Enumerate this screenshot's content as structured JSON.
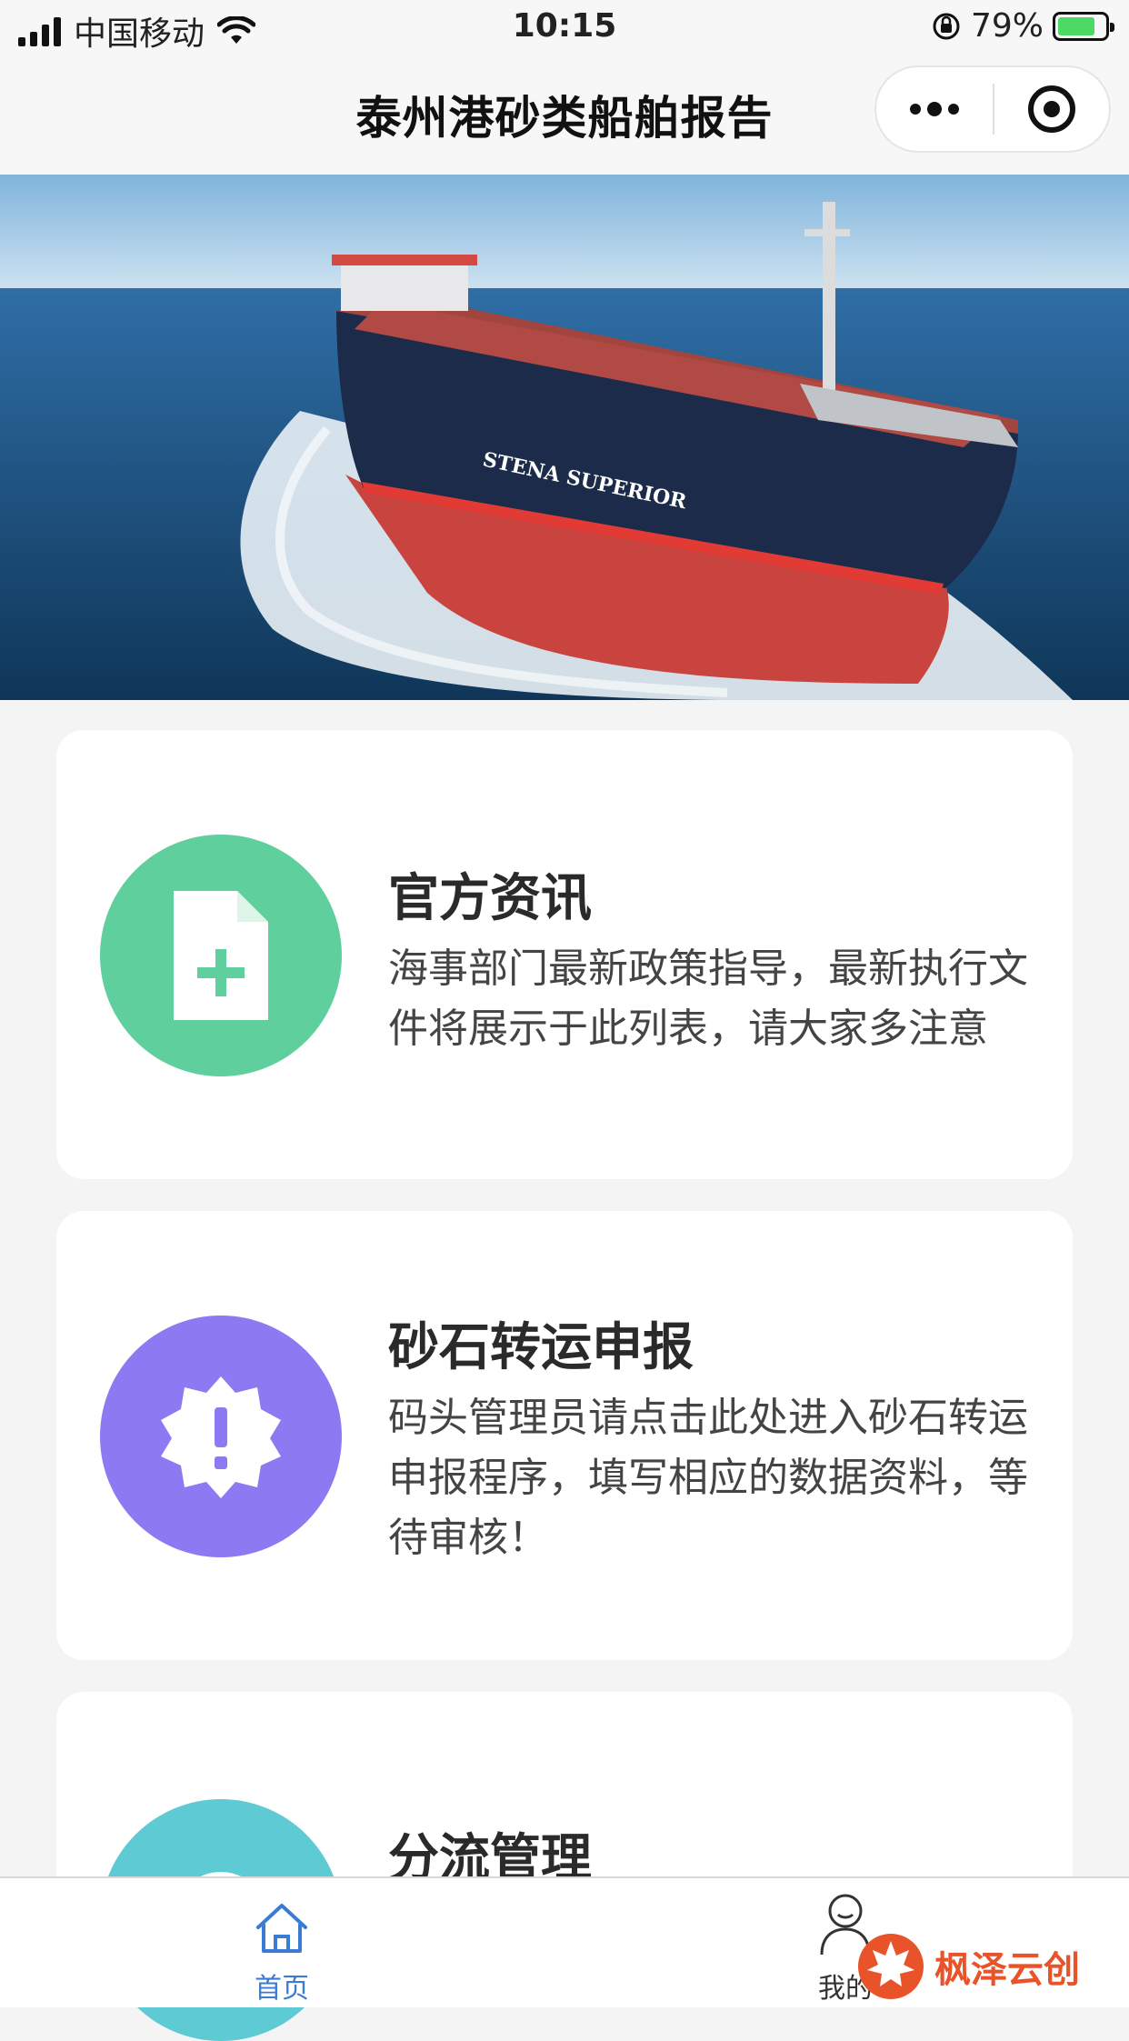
{
  "status_bar": {
    "carrier": "中国移动",
    "time": "10:15",
    "battery_percent": "79%",
    "battery_level": 0.79
  },
  "nav": {
    "title": "泰州港砂类船舶报告"
  },
  "banner": {
    "ship_name_text": "STENA SUPERIOR"
  },
  "cards": [
    {
      "title": "官方资讯",
      "desc": "海事部门最新政策指导，最新执行文件将展示于此列表，请大家多注意",
      "icon": "document-add-icon",
      "color": "#5fcf9d"
    },
    {
      "title": "砂石转运申报",
      "desc": "码头管理员请点击此处进入砂石转运申报程序，填写相应的数据资料，等待审核！",
      "icon": "alert-badge-icon",
      "color": "#8d7af2"
    },
    {
      "title": "分流管理",
      "desc": "",
      "icon": "diversion-icon",
      "color": "#5ecad3"
    }
  ],
  "tab_bar": {
    "tabs": [
      {
        "label": "首页",
        "icon": "home-icon",
        "active": true,
        "color": "#3a7bd5"
      },
      {
        "label": "我的",
        "icon": "user-icon",
        "active": false,
        "color": "#333333"
      }
    ]
  },
  "watermark": {
    "text": "枫泽云创"
  }
}
